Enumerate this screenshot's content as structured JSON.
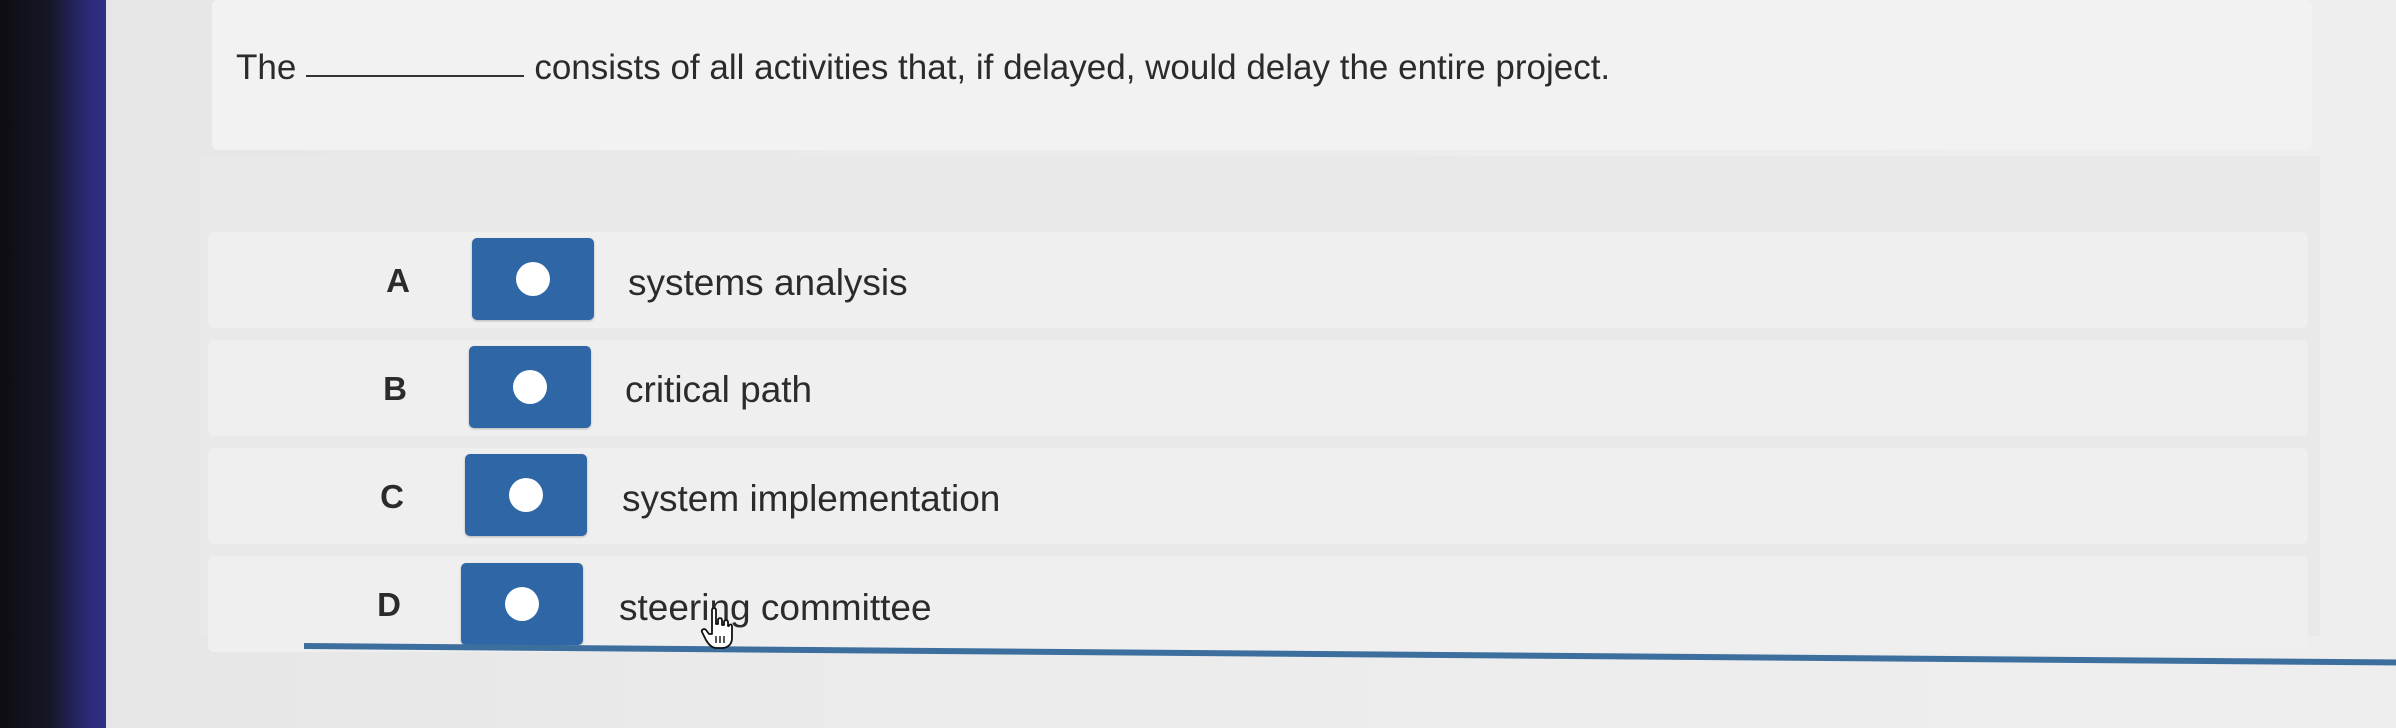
{
  "question": {
    "before_blank": "The",
    "after_blank": "consists of all activities that, if delayed, would delay the entire project."
  },
  "options": [
    {
      "letter": "A",
      "text": "systems analysis"
    },
    {
      "letter": "B",
      "text": "critical path"
    },
    {
      "letter": "C",
      "text": "system implementation"
    },
    {
      "letter": "D",
      "text": "steering committee"
    }
  ],
  "colors": {
    "radio_button": "#2f66a6",
    "divider": "#3c6e9e"
  },
  "icons": {
    "cursor": "hand-pointer-icon"
  }
}
